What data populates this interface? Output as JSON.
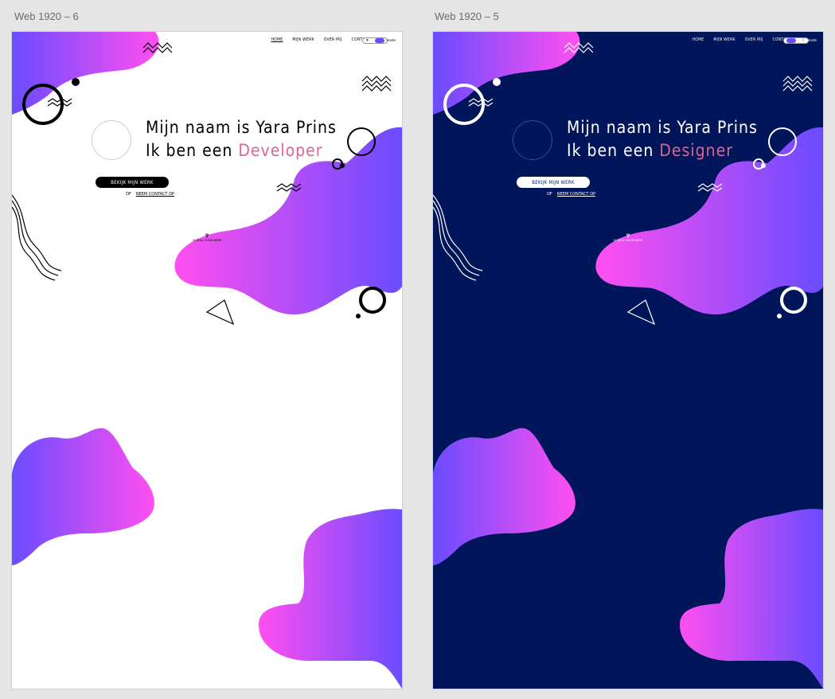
{
  "artboards": [
    {
      "label": "Web 1920 – 6",
      "theme": "light",
      "background": "#ffffff",
      "text_color": "#000000",
      "nav": [
        "HOME",
        "MIJN WERK",
        "OVER MIJ",
        "CONTACT"
      ],
      "toggle_text": "mode",
      "headline_line1": "Mijn naam is Yara Prins",
      "headline_line2_prefix": "Ik ben een ",
      "headline_role": "Developer",
      "cta_label": "BEKIJK MIJN WERK",
      "or_label": "OF",
      "contact_link": "NEEM CONTACT OP",
      "scroll_label": "SCROLL VOOR MEER"
    },
    {
      "label": "Web 1920 – 5",
      "theme": "dark",
      "background": "#00155a",
      "text_color": "#ffffff",
      "nav": [
        "HOME",
        "MIJN WERK",
        "OVER MIJ",
        "CONTACT"
      ],
      "toggle_text": "mode",
      "headline_line1": "Mijn naam is Yara Prins",
      "headline_line2_prefix": "Ik ben een ",
      "headline_role": "Designer",
      "cta_label": "BEKIJK MIJN WERK",
      "or_label": "OF",
      "contact_link": "NEEM CONTACT OP",
      "scroll_label": "SCROLL VOOR MEER"
    }
  ],
  "colors": {
    "accent_pink": "#e2648a",
    "gradient_purple": "#6a4cff",
    "gradient_magenta": "#ff4ff0",
    "canvas_bg": "#e5e5e5"
  }
}
